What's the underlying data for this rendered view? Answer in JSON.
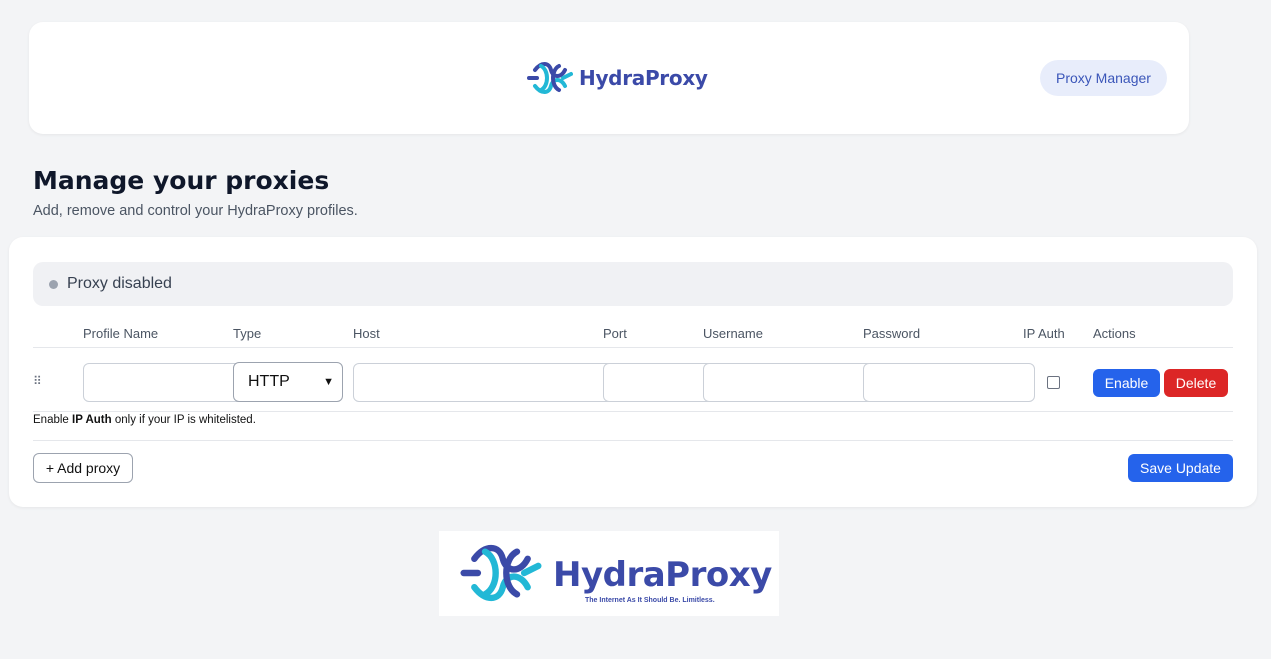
{
  "header": {
    "brand": "HydraProxy",
    "manager_label": "Proxy Manager"
  },
  "page": {
    "title": "Manage your proxies",
    "subtitle": "Add, remove and control your HydraProxy profiles."
  },
  "status": {
    "text": "Proxy disabled",
    "dot_color": "#9ca3af"
  },
  "table": {
    "columns": [
      "Profile Name",
      "Type",
      "Host",
      "Port",
      "Username",
      "Password",
      "IP Auth",
      "Actions"
    ],
    "row": {
      "profile_name": "",
      "type": "HTTP",
      "host": "",
      "port": "",
      "username": "",
      "password": "",
      "ip_auth": false,
      "enable_label": "Enable",
      "delete_label": "Delete"
    }
  },
  "hint": {
    "prefix": "Enable",
    "bold": "IP Auth",
    "suffix": "only if your IP is whitelisted."
  },
  "footer": {
    "add_label": "+ Add proxy",
    "save_label": "Save Update"
  },
  "banner": {
    "brand": "HydraProxy",
    "tagline": "The Internet As It Should Be. Limitless."
  },
  "colors": {
    "primary": "#2563eb",
    "danger": "#dc2626",
    "brand": "#3b4aa8",
    "brand_accent": "#22b8d6"
  }
}
